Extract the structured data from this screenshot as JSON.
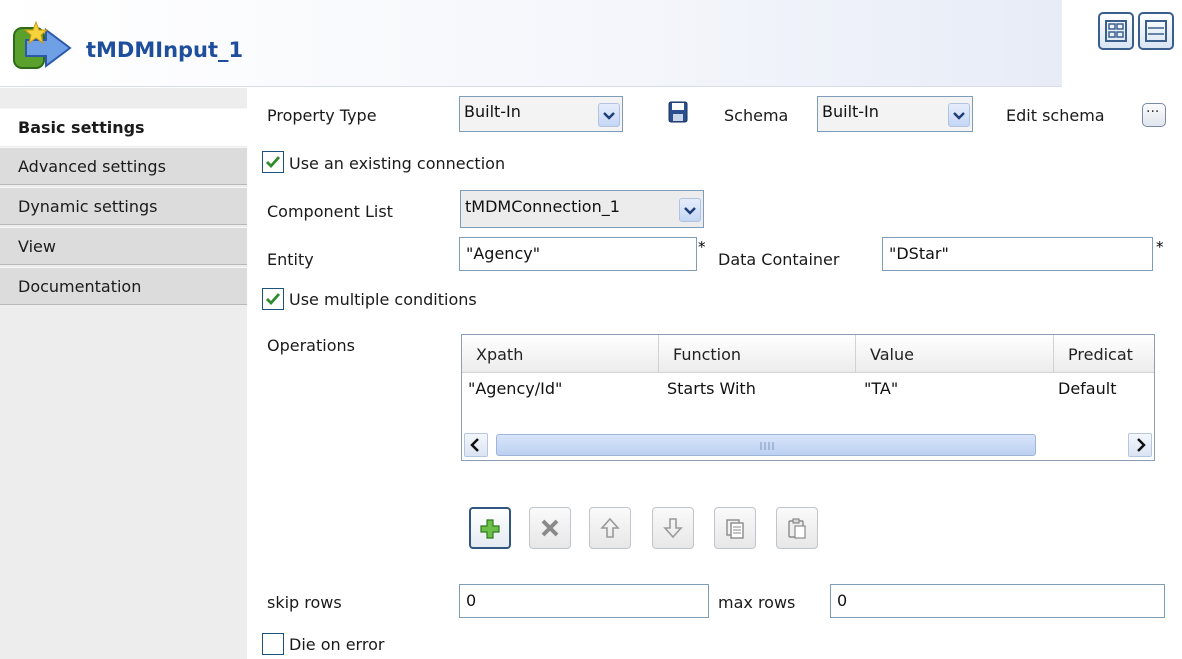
{
  "header": {
    "title": "tMDMInput_1",
    "icon": "component-arrow-icon"
  },
  "layout_buttons": {
    "icons": [
      "grid-layout-icon",
      "row-layout-icon"
    ]
  },
  "tabs": [
    {
      "label": "Basic settings",
      "active": true
    },
    {
      "label": "Advanced settings",
      "active": false
    },
    {
      "label": "Dynamic settings",
      "active": false
    },
    {
      "label": "View",
      "active": false
    },
    {
      "label": "Documentation",
      "active": false
    }
  ],
  "form": {
    "property_type_label": "Property Type",
    "property_type_value": "Built-In",
    "schema_label": "Schema",
    "schema_value": "Built-In",
    "edit_schema_label": "Edit schema",
    "edit_schema_button": "...",
    "use_existing_connection_label": "Use an existing connection",
    "use_existing_connection_checked": true,
    "component_list_label": "Component List",
    "component_list_value": "tMDMConnection_1",
    "entity_label": "Entity",
    "entity_value": "\"Agency\"",
    "required_mark": "*",
    "data_container_label": "Data Container",
    "data_container_value": "\"DStar\"",
    "use_multiple_conditions_label": "Use multiple conditions",
    "use_multiple_conditions_checked": true,
    "operations_label": "Operations",
    "skip_rows_label": "skip rows",
    "skip_rows_value": "0",
    "max_rows_label": "max rows",
    "max_rows_value": "0",
    "die_on_error_label": "Die on error",
    "die_on_error_checked": false
  },
  "operations_table": {
    "columns": [
      "Xpath",
      "Function",
      "Value",
      "Predicat"
    ],
    "rows": [
      [
        "\"Agency/Id\"",
        "Starts With",
        "\"TA\"",
        "Default"
      ]
    ]
  },
  "toolbar": {
    "buttons": [
      {
        "icon": "add-icon",
        "enabled": true
      },
      {
        "icon": "delete-icon",
        "enabled": false
      },
      {
        "icon": "move-up-icon",
        "enabled": false
      },
      {
        "icon": "move-down-icon",
        "enabled": false
      },
      {
        "icon": "copy-icon",
        "enabled": false
      },
      {
        "icon": "paste-icon",
        "enabled": false
      }
    ]
  },
  "colors": {
    "title": "#1f4f9c",
    "sidebar": "#dcdcdc",
    "field_border": "#7f9db9",
    "check": "#2e8b2e"
  }
}
